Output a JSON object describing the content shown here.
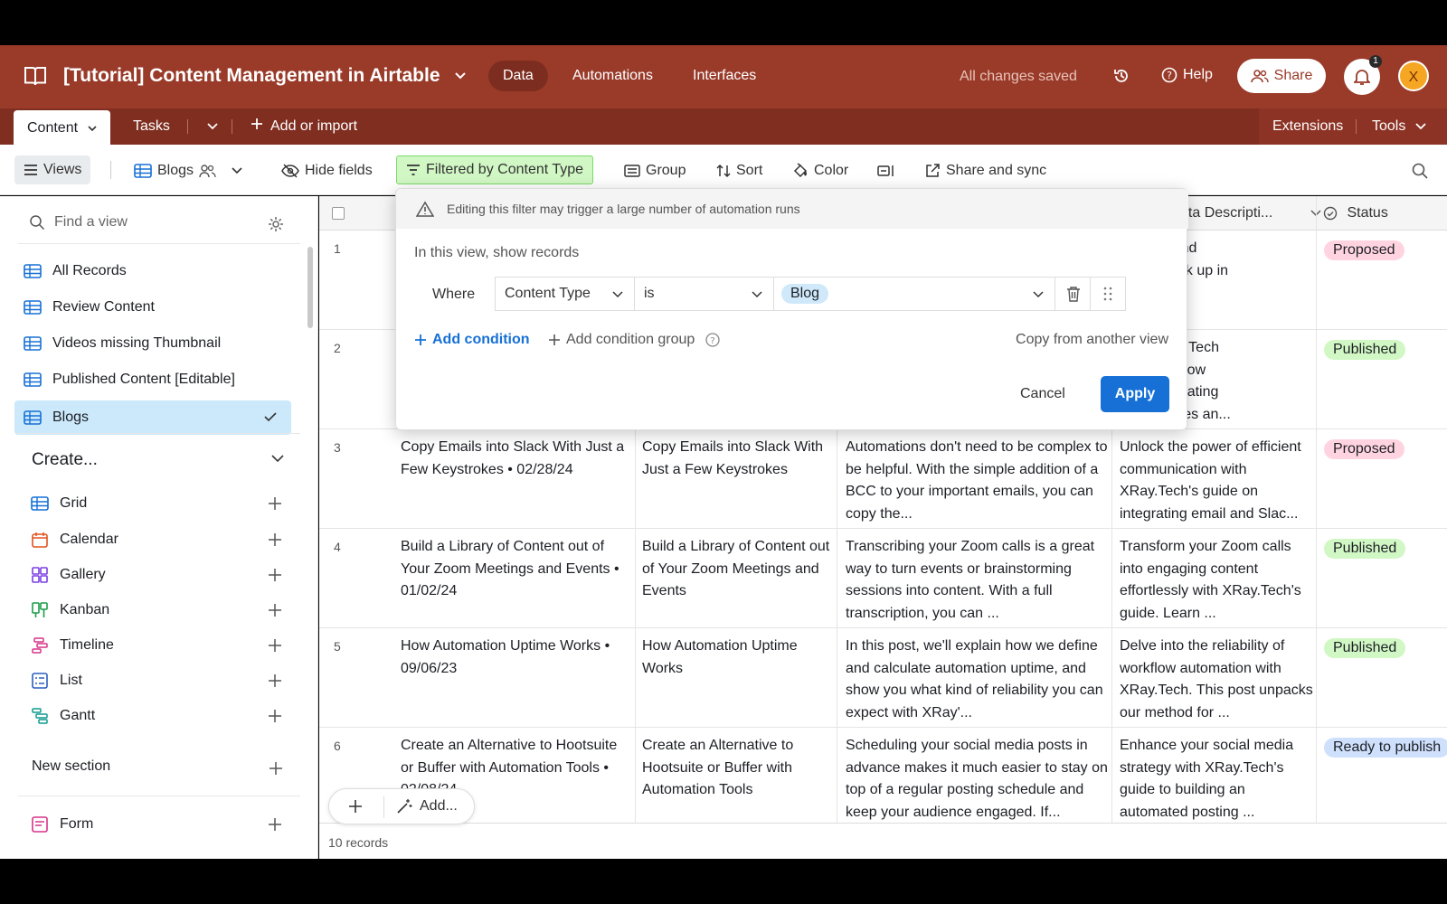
{
  "header": {
    "base_title": "[Tutorial] Content Management in Airtable",
    "nav": [
      "Data",
      "Automations",
      "Interfaces"
    ],
    "saved_status": "All changes saved",
    "help_label": "Help",
    "share_label": "Share",
    "notification_count": "1",
    "avatar_initial": "X"
  },
  "tabs": {
    "items": [
      "Content",
      "Tasks"
    ],
    "add_or_import": "Add or import",
    "extensions": "Extensions",
    "tools": "Tools"
  },
  "toolbar": {
    "views": "Views",
    "current_view": "Blogs",
    "hide_fields": "Hide fields",
    "filter": "Filtered by Content Type",
    "group": "Group",
    "sort": "Sort",
    "color": "Color",
    "share_sync": "Share and sync"
  },
  "sidebar": {
    "find_placeholder": "Find a view",
    "views": [
      "All Records",
      "Review Content",
      "Videos missing Thumbnail",
      "Published Content [Editable]",
      "Blogs"
    ],
    "create_title": "Create...",
    "create_items": [
      "Grid",
      "Calendar",
      "Gallery",
      "Kanban",
      "Timeline",
      "List",
      "Gantt"
    ],
    "new_section": "New section",
    "form": "Form"
  },
  "grid": {
    "headers": {
      "meta": "eta Descripti...",
      "status": "Status"
    },
    "rows": [
      {
        "num": "1",
        "name": "",
        "title": "",
        "excerpt": "",
        "meta": "Airtable and\nheets stack up in\nrehensive\non.",
        "status": "Proposed"
      },
      {
        "num": "2",
        "name": "",
        "title": "",
        "excerpt": "",
        "meta": "how XRay.Tech\nizes workflow\nn by integrating\no databases an...",
        "status": "Published"
      },
      {
        "num": "3",
        "name": "Copy Emails into Slack With Just a Few Keystrokes • 02/28/24",
        "title": "Copy Emails into Slack With Just a Few Keystrokes",
        "excerpt": "Automations don't need to be complex to be helpful. With the simple addition of a BCC to your important emails, you can copy the...",
        "meta": "Unlock the power of efficient communication with XRay.Tech's guide on integrating email and Slac...",
        "status": "Proposed"
      },
      {
        "num": "4",
        "name": "Build a Library of Content out of Your Zoom Meetings and Events • 01/02/24",
        "title": "Build a Library of Content out of Your Zoom Meetings and Events",
        "excerpt": "Transcribing your Zoom calls is a great way to turn events or brainstorming sessions into content. With a full transcription, you can ...",
        "meta": "Transform your Zoom calls into engaging content effortlessly with XRay.Tech's guide. Learn ...",
        "status": "Published"
      },
      {
        "num": "5",
        "name": "How Automation Uptime Works • 09/06/23",
        "title": "How Automation Uptime Works",
        "excerpt": "In this post, we'll explain how we define and calculate automation uptime, and show you what kind of reliability you can expect with XRay'...",
        "meta": "Delve into the reliability of workflow automation with XRay.Tech. This post unpacks our method for ...",
        "status": "Published"
      },
      {
        "num": "6",
        "name": "Create an Alternative to Hootsuite or Buffer with Automation Tools • 02/08/24",
        "title": "Create an Alternative to Hootsuite or Buffer with Automation Tools",
        "excerpt": "Scheduling your social media posts in advance makes it much easier to stay on top of a regular posting schedule and keep your audience engaged. If...",
        "meta": "Enhance your social media strategy with XRay.Tech's guide to building an automated posting ...",
        "status": "Ready to publish"
      }
    ],
    "add_label": "Add...",
    "records_count": "10 records"
  },
  "status_colors": {
    "Proposed": "#ffd4e0",
    "Published": "#d1f7c4",
    "Ready to publish": "#cfe0fc"
  },
  "filter": {
    "warning": "Editing this filter may trigger a large number of automation runs",
    "show_label": "In this view, show records",
    "where": "Where",
    "field": "Content Type",
    "operator": "is",
    "value": "Blog",
    "add_condition": "Add condition",
    "add_group": "Add condition group",
    "copy_from": "Copy from another view",
    "cancel": "Cancel",
    "apply": "Apply"
  },
  "colors": {
    "header_bg": "#9a3b2a",
    "accent_blue": "#1670d6",
    "filter_green": "#d1f7c4"
  }
}
